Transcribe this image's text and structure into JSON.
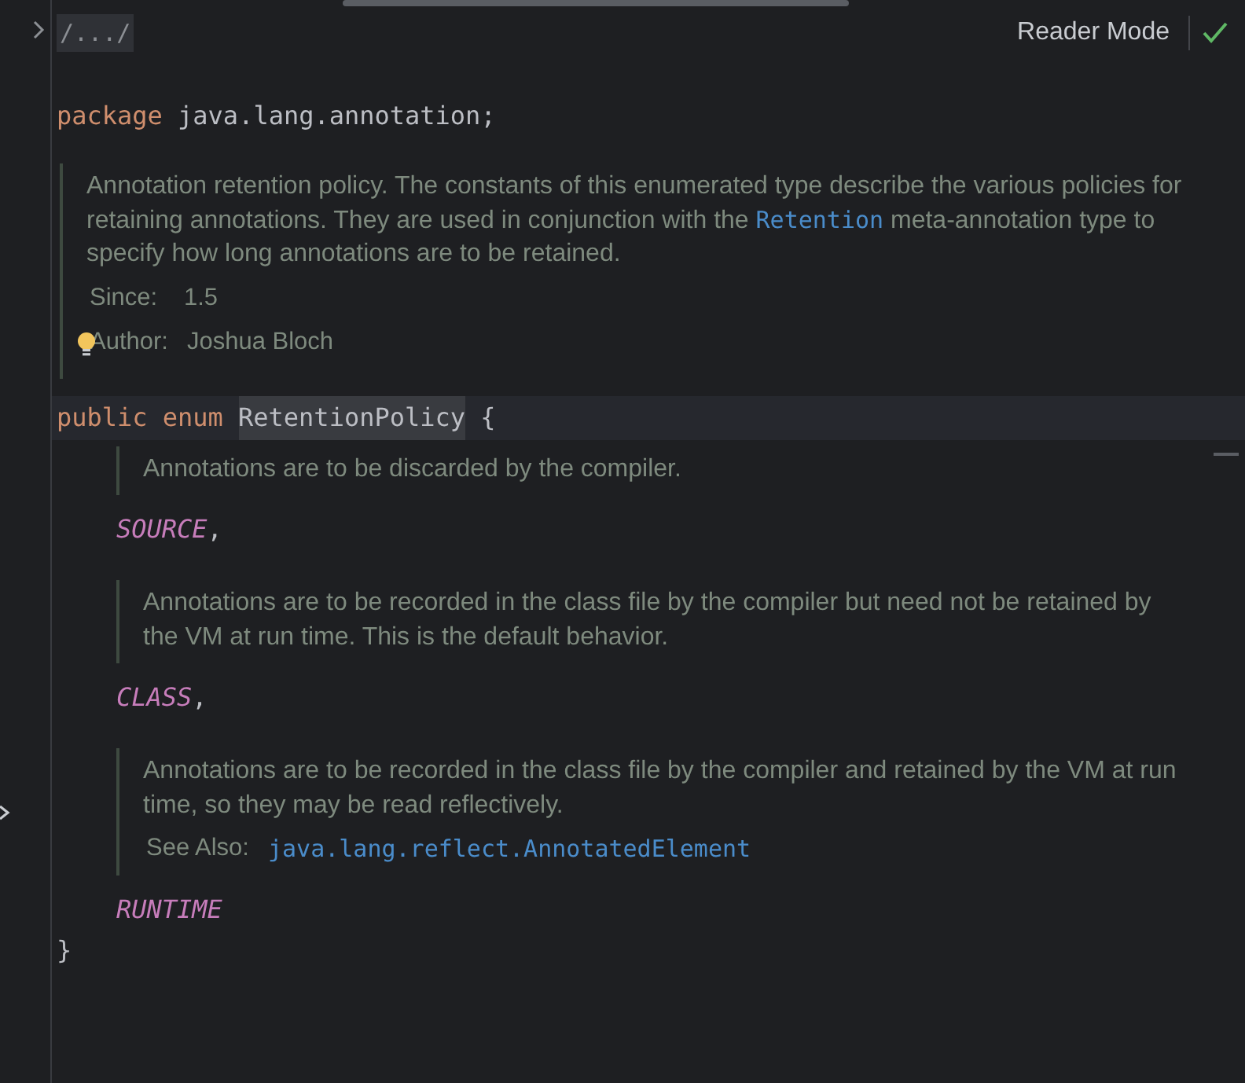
{
  "top_bar": {
    "breadcrumb": "/.../",
    "mode_label": "Reader Mode",
    "mode_on": true
  },
  "package_line": [
    {
      "kind": "keyword",
      "text": "package"
    },
    {
      "kind": "plain",
      "text": "java.lang.annotation;"
    }
  ],
  "class_doc": {
    "paragraph": [
      {
        "kind": "text",
        "text": "Annotation retention policy. The constants of this enumerated type describe the various policies for retaining annotations. They are used in conjunction with the"
      },
      {
        "kind": "link",
        "text": "Retention"
      },
      {
        "kind": "text",
        "text": "meta-annotation type to specify how long annotations are to be retained."
      }
    ],
    "tags": [
      {
        "label": "Since:",
        "value": "1.5"
      },
      {
        "label": "Author:",
        "value": "Joshua Bloch"
      }
    ]
  },
  "declaration": {
    "current": true,
    "tokens": [
      {
        "kind": "keyword",
        "text": "public"
      },
      {
        "kind": "keyword",
        "text": "enum"
      },
      {
        "kind": "declared",
        "text": "RetentionPolicy"
      },
      {
        "kind": "plain",
        "text": "{"
      }
    ]
  },
  "constants": [
    {
      "doc": [
        {
          "kind": "text",
          "text": "Annotations are to be discarded by the compiler."
        }
      ],
      "name": "SOURCE",
      "punct": ","
    },
    {
      "doc": [
        {
          "kind": "text",
          "text": "Annotations are to be recorded in the class file by the compiler but need not be retained by the VM at run time. This is the default behavior."
        }
      ],
      "name": "CLASS",
      "punct": ","
    },
    {
      "doc": [
        {
          "kind": "text",
          "text": "Annotations are to be recorded in the class file by the compiler and retained by the VM at run time, so they may be read reflectively."
        }
      ],
      "see_also": {
        "label": "See Also:",
        "link": "java.lang.reflect.AnnotatedElement"
      },
      "name": "RUNTIME"
    }
  ],
  "closing": "}"
}
